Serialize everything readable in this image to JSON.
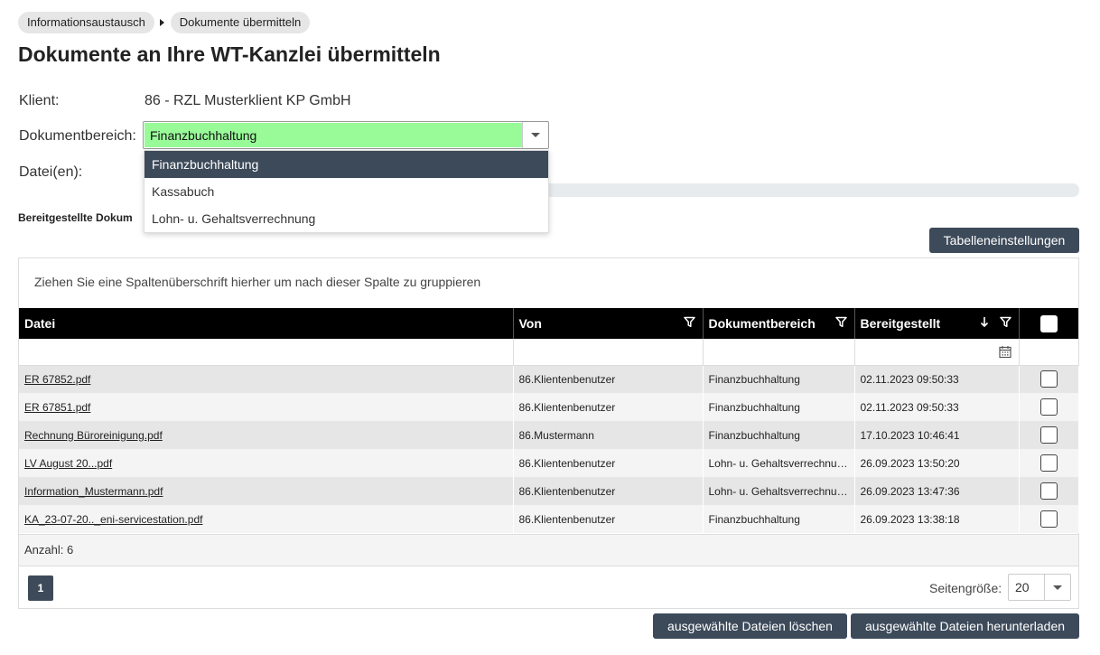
{
  "breadcrumb": {
    "items": [
      "Informationsaustausch",
      "Dokumente übermitteln"
    ]
  },
  "page_title": "Dokumente an Ihre WT-Kanzlei übermitteln",
  "form": {
    "client_label": "Klient:",
    "client_value": "86 - RZL Musterklient KP GmbH",
    "area_label": "Dokumentbereich:",
    "area_value": "Finanzbuchhaltung",
    "files_label": "Datei(en):"
  },
  "dropdown": {
    "options": [
      "Finanzbuchhaltung",
      "Kassabuch",
      "Lohn- u. Gehaltsverrechnung"
    ],
    "selected_index": 0
  },
  "section_heading": "Bereitgestellte Dokum",
  "table_settings_button": "Tabelleneinstellungen",
  "grid": {
    "group_hint": "Ziehen Sie eine Spaltenüberschrift hierher um nach dieser Spalte zu gruppieren",
    "columns": [
      "Datei",
      "Von",
      "Dokumentbereich",
      "Bereitgestellt"
    ],
    "rows": [
      {
        "file": "ER 67852.pdf",
        "from": "86.Klientenbenutzer",
        "area": "Finanzbuchhaltung",
        "date": "02.11.2023 09:50:33"
      },
      {
        "file": "ER 67851.pdf",
        "from": "86.Klientenbenutzer",
        "area": "Finanzbuchhaltung",
        "date": "02.11.2023 09:50:33"
      },
      {
        "file": "Rechnung Büroreinigung.pdf",
        "from": "86.Mustermann",
        "area": "Finanzbuchhaltung",
        "date": "17.10.2023 10:46:41"
      },
      {
        "file": "LV August 20...pdf",
        "from": "86.Klientenbenutzer",
        "area": "Lohn- u. Gehaltsverrechnu…",
        "date": "26.09.2023 13:50:20"
      },
      {
        "file": "Information_Mustermann.pdf",
        "from": "86.Klientenbenutzer",
        "area": "Lohn- u. Gehaltsverrechnu…",
        "date": "26.09.2023 13:47:36"
      },
      {
        "file": "KA_23-07-20.._eni-servicestation.pdf",
        "from": "86.Klientenbenutzer",
        "area": "Finanzbuchhaltung",
        "date": "26.09.2023 13:38:18"
      }
    ],
    "count_text": "Anzahl: 6",
    "current_page": "1",
    "page_size_label": "Seitengröße:",
    "page_size": "20"
  },
  "buttons": {
    "delete": "ausgewählte Dateien löschen",
    "download": "ausgewählte Dateien herunterladen"
  },
  "colors": {
    "accent": "#3d4a5a",
    "selected_field": "#98fb98",
    "header_bg": "#000000"
  }
}
